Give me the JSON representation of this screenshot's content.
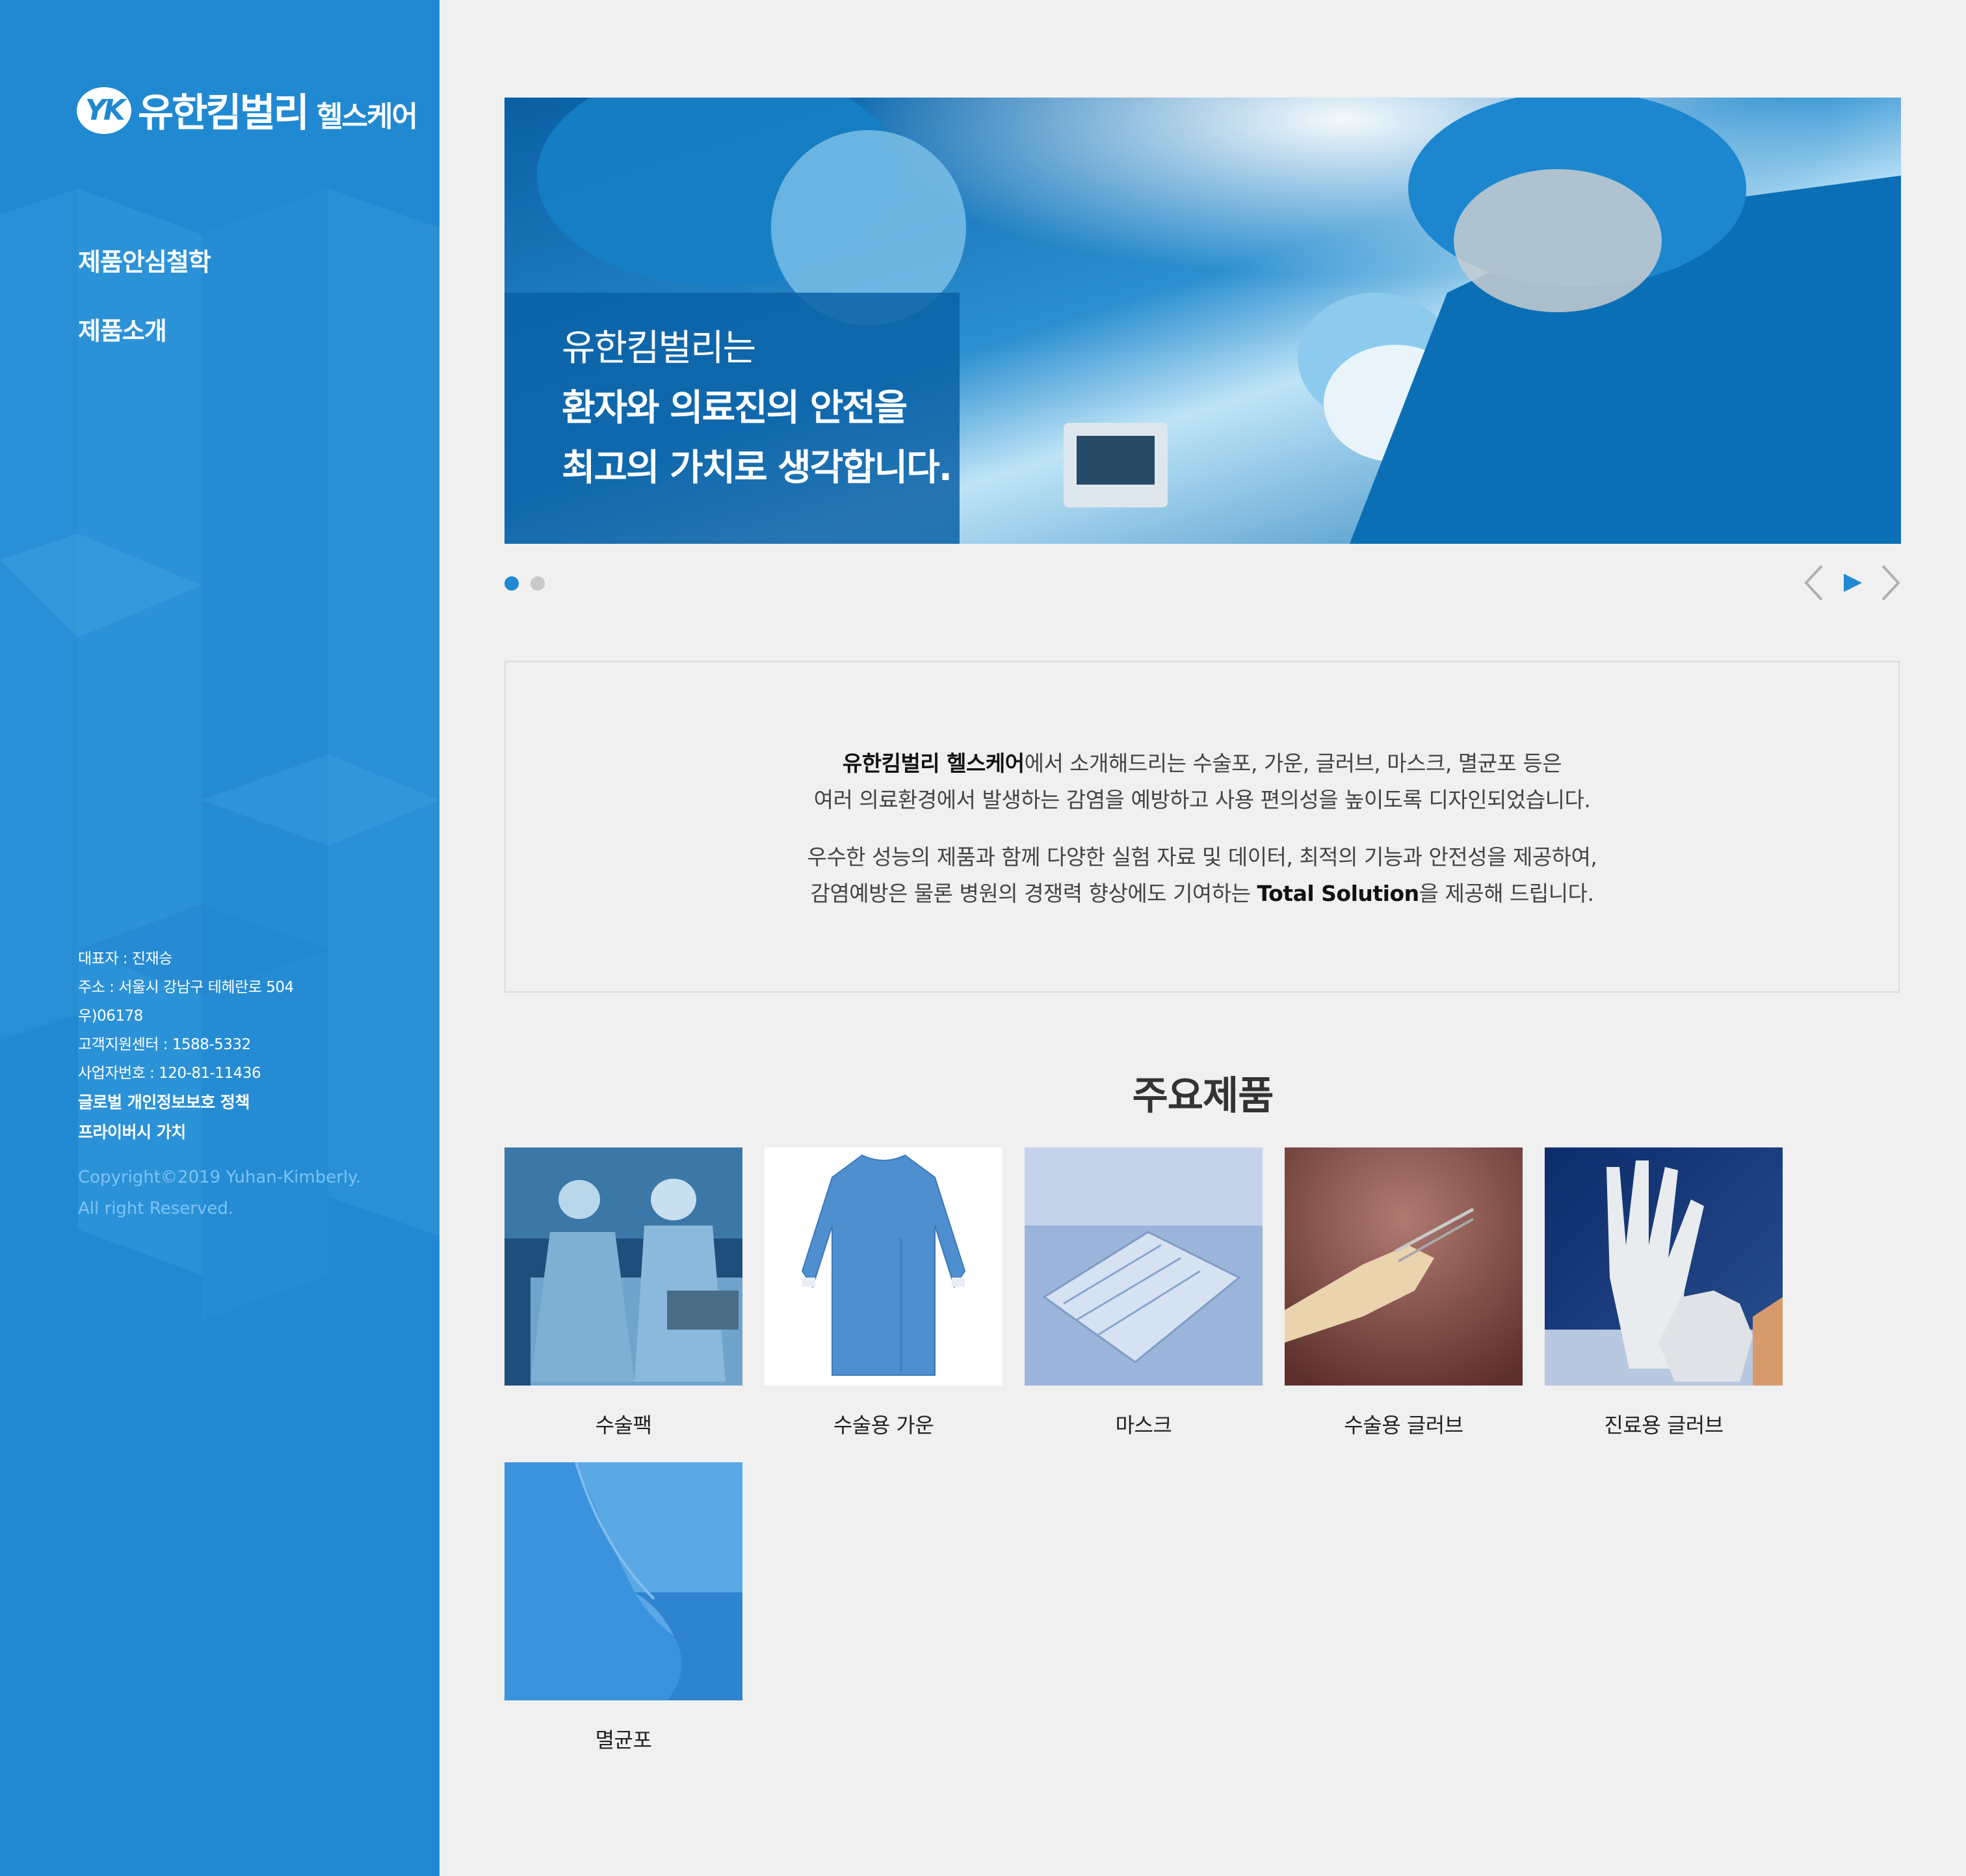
{
  "colors": {
    "brand_blue": "#2089d2",
    "page_bg": "#f0f0f0",
    "copyright": "#7ec3f3",
    "dot_inactive": "#c9c9c9"
  },
  "sidebar": {
    "logo": {
      "mark": "YK",
      "name": "유한킴벌리",
      "sub": "헬스케어"
    },
    "nav": [
      {
        "label": "제품안심철학"
      },
      {
        "label": "제품소개"
      }
    ],
    "company": {
      "ceo": "대표자 : 진재승",
      "address": "주소 : 서울시 강남구 테헤란로 504",
      "zip": "우)06178",
      "cs_center": "고객지원센터 : 1588-5332",
      "biz_no": "사업자번호 : 120-81-11436",
      "privacy_policy": "글로벌 개인정보보호 정책",
      "privacy_value": "프라이버시 가치",
      "copyright_1": "Copyright©2019 Yuhan-Kimberly.",
      "copyright_2": "All right Reserved."
    }
  },
  "banner": {
    "line1": "유한킴벌리는",
    "line2": "환자와 의료진의 안전을",
    "line3": "최고의 가치로 생각합니다.",
    "slide_count": 2,
    "active_slide": 1,
    "icons": {
      "prev": "chevron-left-icon",
      "play": "play-icon",
      "next": "chevron-right-icon"
    }
  },
  "intro": {
    "p1_bold": "유한킴벌리 헬스케어",
    "p1_rest": "에서 소개해드리는 수술포, 가운, 글러브, 마스크, 멸균포 등은",
    "p1_line2": "여러 의료환경에서 발생하는 감염을 예방하고 사용 편의성을 높이도록 디자인되었습니다.",
    "p2_line1": "우수한 성능의 제품과 함께 다양한 실험 자료 및 데이터, 최적의 기능과 안전성을 제공하여,",
    "p2_pre": "감염예방은 물론 병원의 경쟁력 향상에도 기여하는 ",
    "p2_bold": "Total Solution",
    "p2_post": "을 제공해 드립니다."
  },
  "products": {
    "title": "주요제품",
    "items": [
      {
        "name": "수술팩"
      },
      {
        "name": "수술용 가운"
      },
      {
        "name": "마스크"
      },
      {
        "name": "수술용 글러브"
      },
      {
        "name": "진료용 글러브"
      },
      {
        "name": "멸균포"
      }
    ]
  }
}
